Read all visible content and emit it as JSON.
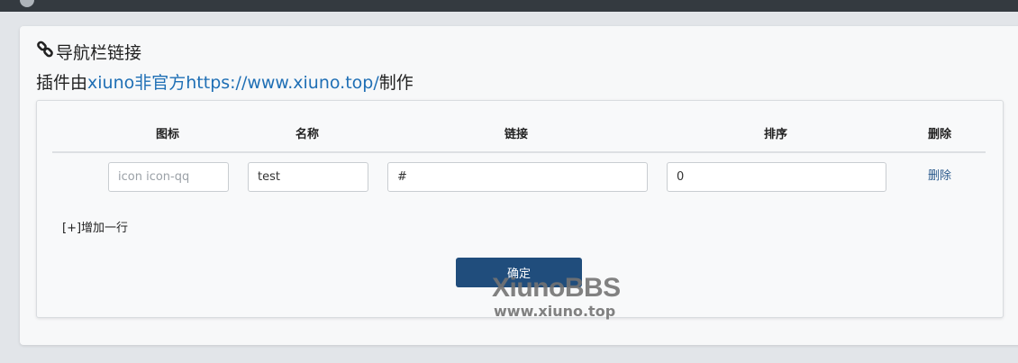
{
  "header": {
    "title": "导航栏链接",
    "title_icon": "link-icon"
  },
  "credit": {
    "prefix": "插件由",
    "author": "xiuno非官方",
    "url": "https://www.xiuno.top/",
    "suffix": "制作"
  },
  "table": {
    "columns": [
      "图标",
      "名称",
      "链接",
      "排序",
      "删除"
    ],
    "rows": [
      {
        "icon_placeholder": "icon icon-qq",
        "icon_value": "",
        "name_value": "test",
        "link_value": "#",
        "order_value": "0",
        "delete_label": "删除"
      }
    ]
  },
  "add_row_label": "[+]增加一行",
  "confirm_label": "确定",
  "watermark": {
    "title": "XiunoBBS",
    "url": "www.xiuno.top"
  },
  "colors": {
    "link": "#1f6fb5",
    "button": "#204d7c",
    "topbar": "#343a40"
  }
}
